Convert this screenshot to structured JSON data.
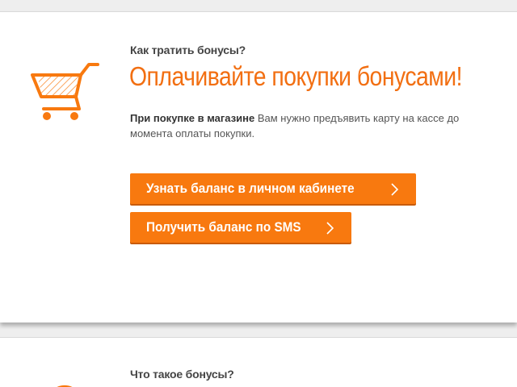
{
  "colors": {
    "accent": "#f26f12",
    "button": "#f8790f",
    "button_text": "#ffffff",
    "background": "#eeeeee",
    "card": "#ffffff"
  },
  "section1": {
    "icon": "shopping-cart-icon",
    "eyebrow": "Как тратить бонусы?",
    "headline": "Оплачивайте покупки бонусами!",
    "desc_bold": "При покупке в магазине",
    "desc_text": " Вам нужно предъявить карту на кассе до момента оплаты покупки.",
    "buttons": [
      {
        "label": "Узнать баланс в личном кабинете",
        "icon": "chevron-right-icon"
      },
      {
        "label": "Получить баланс по SMS",
        "icon": "chevron-right-icon"
      }
    ]
  },
  "section2": {
    "eyebrow": "Что такое бонусы?"
  }
}
